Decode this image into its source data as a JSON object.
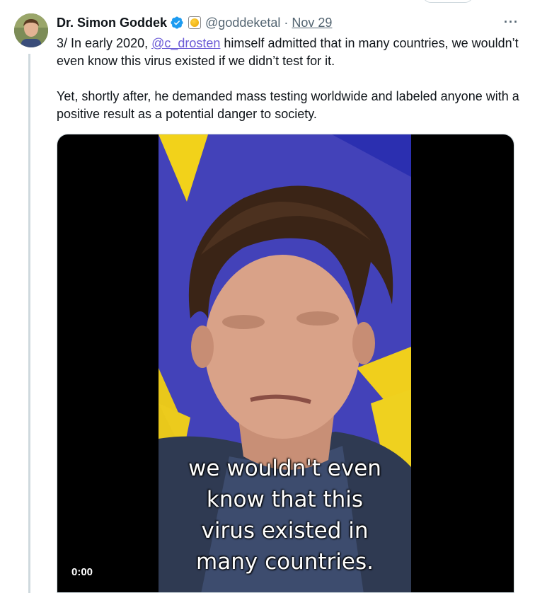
{
  "colors": {
    "text": "#0f1419",
    "secondary": "#536471",
    "link": "#6b5bd6",
    "verified": "#1d9bf0",
    "video_bg": "#000000"
  },
  "tweet": {
    "author_name": "Dr. Simon Goddek",
    "handle": "@goddeketal",
    "separator": "·",
    "date": "Nov 29",
    "more_icon": "···",
    "text_line1_before": "3/ In early 2020, ",
    "mention": "@c_drosten",
    "text_line1_after": " himself admitted that in many countries, we wouldn’t even know this virus existed if we didn’t test for it.",
    "text_para2": "Yet, shortly after, he demanded mass testing worldwide and labeled anyone with a positive result as a potential danger to society."
  },
  "video": {
    "caption_lines": [
      "we wouldn't even",
      "know that this",
      "virus existed in",
      "many countries."
    ],
    "timecode": "0:00"
  },
  "icons": {
    "verified": "verified-badge-icon",
    "affiliate": "gold-coin-badge-icon",
    "more": "more-options-icon"
  }
}
